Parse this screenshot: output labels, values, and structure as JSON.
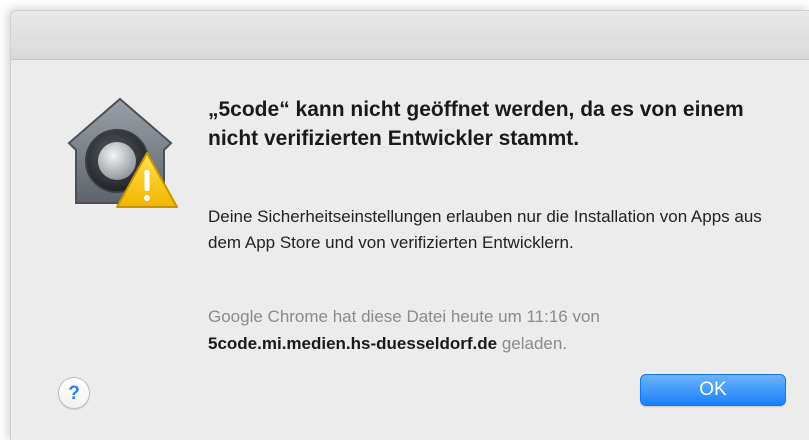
{
  "dialog": {
    "headline": "„5code“ kann nicht geöffnet werden, da es von einem nicht verifizierten Entwickler stammt.",
    "info": "Deine Sicherheitseinstellungen erlauben nur die Installation von Apps aus dem App Store und von verifizierten Entwicklern.",
    "source_prefix": "Google Chrome hat diese Datei heute um 11:16 von",
    "source_domain": "5code.mi.medien.hs-duesseldorf.de",
    "source_suffix": "geladen.",
    "help_label": "?",
    "ok_label": "OK"
  },
  "icons": {
    "app_icon": "gatekeeper-lock-house-icon",
    "warning_badge": "warning-triangle-icon"
  },
  "colors": {
    "accent": "#1a82fb",
    "help": "#2e7cf6",
    "warning": "#f5c400"
  }
}
